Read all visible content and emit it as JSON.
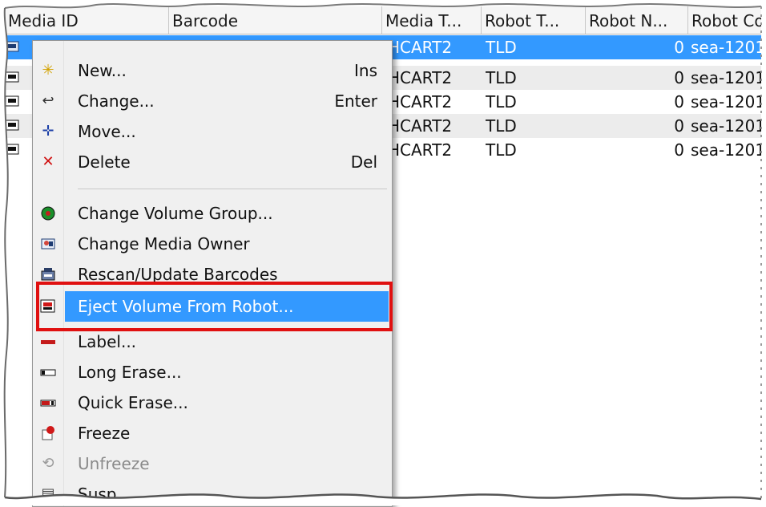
{
  "columns": [
    "Media ID",
    "Barcode",
    "Media T...",
    "Robot T...",
    "Robot N...",
    "Robot Co"
  ],
  "rows": [
    {
      "media_type": "HCART2",
      "robot_type": "TLD",
      "robot_num": "0",
      "robot_control": "sea-1201"
    },
    {
      "media_type": "HCART2",
      "robot_type": "TLD",
      "robot_num": "0",
      "robot_control": "sea-1201"
    },
    {
      "media_type": "HCART2",
      "robot_type": "TLD",
      "robot_num": "0",
      "robot_control": "sea-1201"
    },
    {
      "media_type": "HCART2",
      "robot_type": "TLD",
      "robot_num": "0",
      "robot_control": "sea-1201"
    },
    {
      "media_type": "HCART2",
      "robot_type": "TLD",
      "robot_num": "0",
      "robot_control": "sea-1201"
    }
  ],
  "menu": {
    "new": {
      "label": "New...",
      "shortcut": "Ins"
    },
    "change": {
      "label": "Change...",
      "shortcut": "Enter"
    },
    "move": {
      "label": "Move..."
    },
    "delete": {
      "label": "Delete",
      "shortcut": "Del"
    },
    "change_volume_group": {
      "label": "Change Volume Group..."
    },
    "change_media_owner": {
      "label": "Change Media Owner"
    },
    "rescan": {
      "label": "Rescan/Update Barcodes"
    },
    "eject": {
      "label": "Eject Volume From Robot..."
    },
    "label": {
      "label": "Label..."
    },
    "long_erase": {
      "label": "Long Erase..."
    },
    "quick_erase": {
      "label": "Quick Erase..."
    },
    "freeze": {
      "label": "Freeze"
    },
    "unfreeze": {
      "label": "Unfreeze"
    },
    "suspend": {
      "label": "Susp..."
    }
  },
  "colors": {
    "selection": "#3399ff",
    "highlight_box": "#e01010"
  }
}
